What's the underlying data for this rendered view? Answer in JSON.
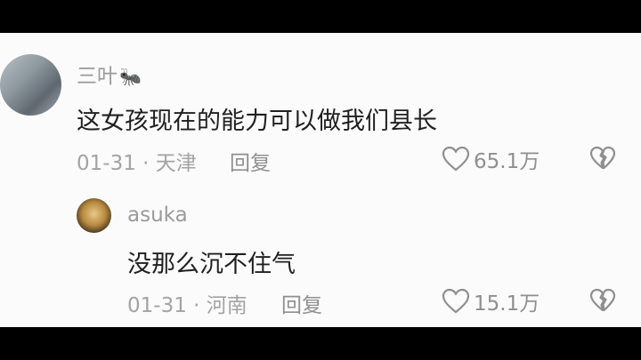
{
  "comments": [
    {
      "username": "三叶",
      "username_icon": "ant-emoji-icon",
      "text": "这女孩现在的能力可以做我们县长",
      "meta": "01-31 · 天津",
      "reply_label": "回复",
      "likes": "65.1万"
    }
  ],
  "replies": [
    {
      "username": "asuka",
      "text": "没那么沉不住气",
      "meta": "01-31 · 河南",
      "reply_label": "回复",
      "likes": "15.1万"
    }
  ],
  "colors": {
    "background_bars": "#000000",
    "panel": "#fbfbfb",
    "text": "#1f1f1f",
    "muted": "#9a9a9a"
  }
}
